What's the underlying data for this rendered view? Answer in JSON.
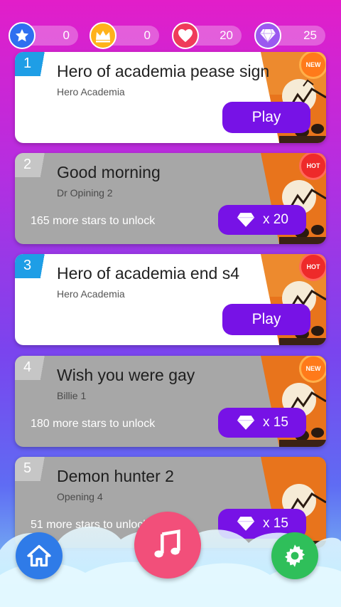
{
  "stats": [
    {
      "icon": "star-icon",
      "value": "0",
      "color": "#2f6ff0"
    },
    {
      "icon": "crown-icon",
      "value": "0",
      "color": "#ffb21a"
    },
    {
      "icon": "heart-icon",
      "value": "20",
      "color": "#ef3b5a"
    },
    {
      "icon": "diamond-icon",
      "value": "25",
      "color": "#9b59f0"
    }
  ],
  "songs": [
    {
      "number": "1",
      "title": "Hero of academia pease sign",
      "artist": "Hero Academia",
      "badge": "NEW",
      "locked": false,
      "action": "Play"
    },
    {
      "number": "2",
      "title": "Good morning",
      "artist": "Dr Opining 2",
      "badge": "HOT",
      "locked": true,
      "unlock_text": "165 more stars to unlock",
      "cost": "x 20"
    },
    {
      "number": "3",
      "title": "Hero of academia end s4",
      "artist": "Hero Academia",
      "badge": "HOT",
      "locked": false,
      "action": "Play"
    },
    {
      "number": "4",
      "title": "Wish you were gay",
      "artist": "Billie 1",
      "badge": "NEW",
      "locked": true,
      "unlock_text": "180 more stars to unlock",
      "cost": "x 15"
    },
    {
      "number": "5",
      "title": "Demon hunter 2",
      "artist": "Opening 4",
      "badge": "",
      "locked": true,
      "unlock_text": "51 more stars to unlock",
      "cost": "x 15"
    }
  ],
  "nav": {
    "home": "home-icon",
    "music": "music-note-icon",
    "settings": "gear-icon"
  },
  "colors": {
    "accent": "#7712e6",
    "unlocked_num": "#1e9ee6",
    "home": "#2f7be8",
    "music": "#f24f7a",
    "settings": "#2fbf5a"
  }
}
